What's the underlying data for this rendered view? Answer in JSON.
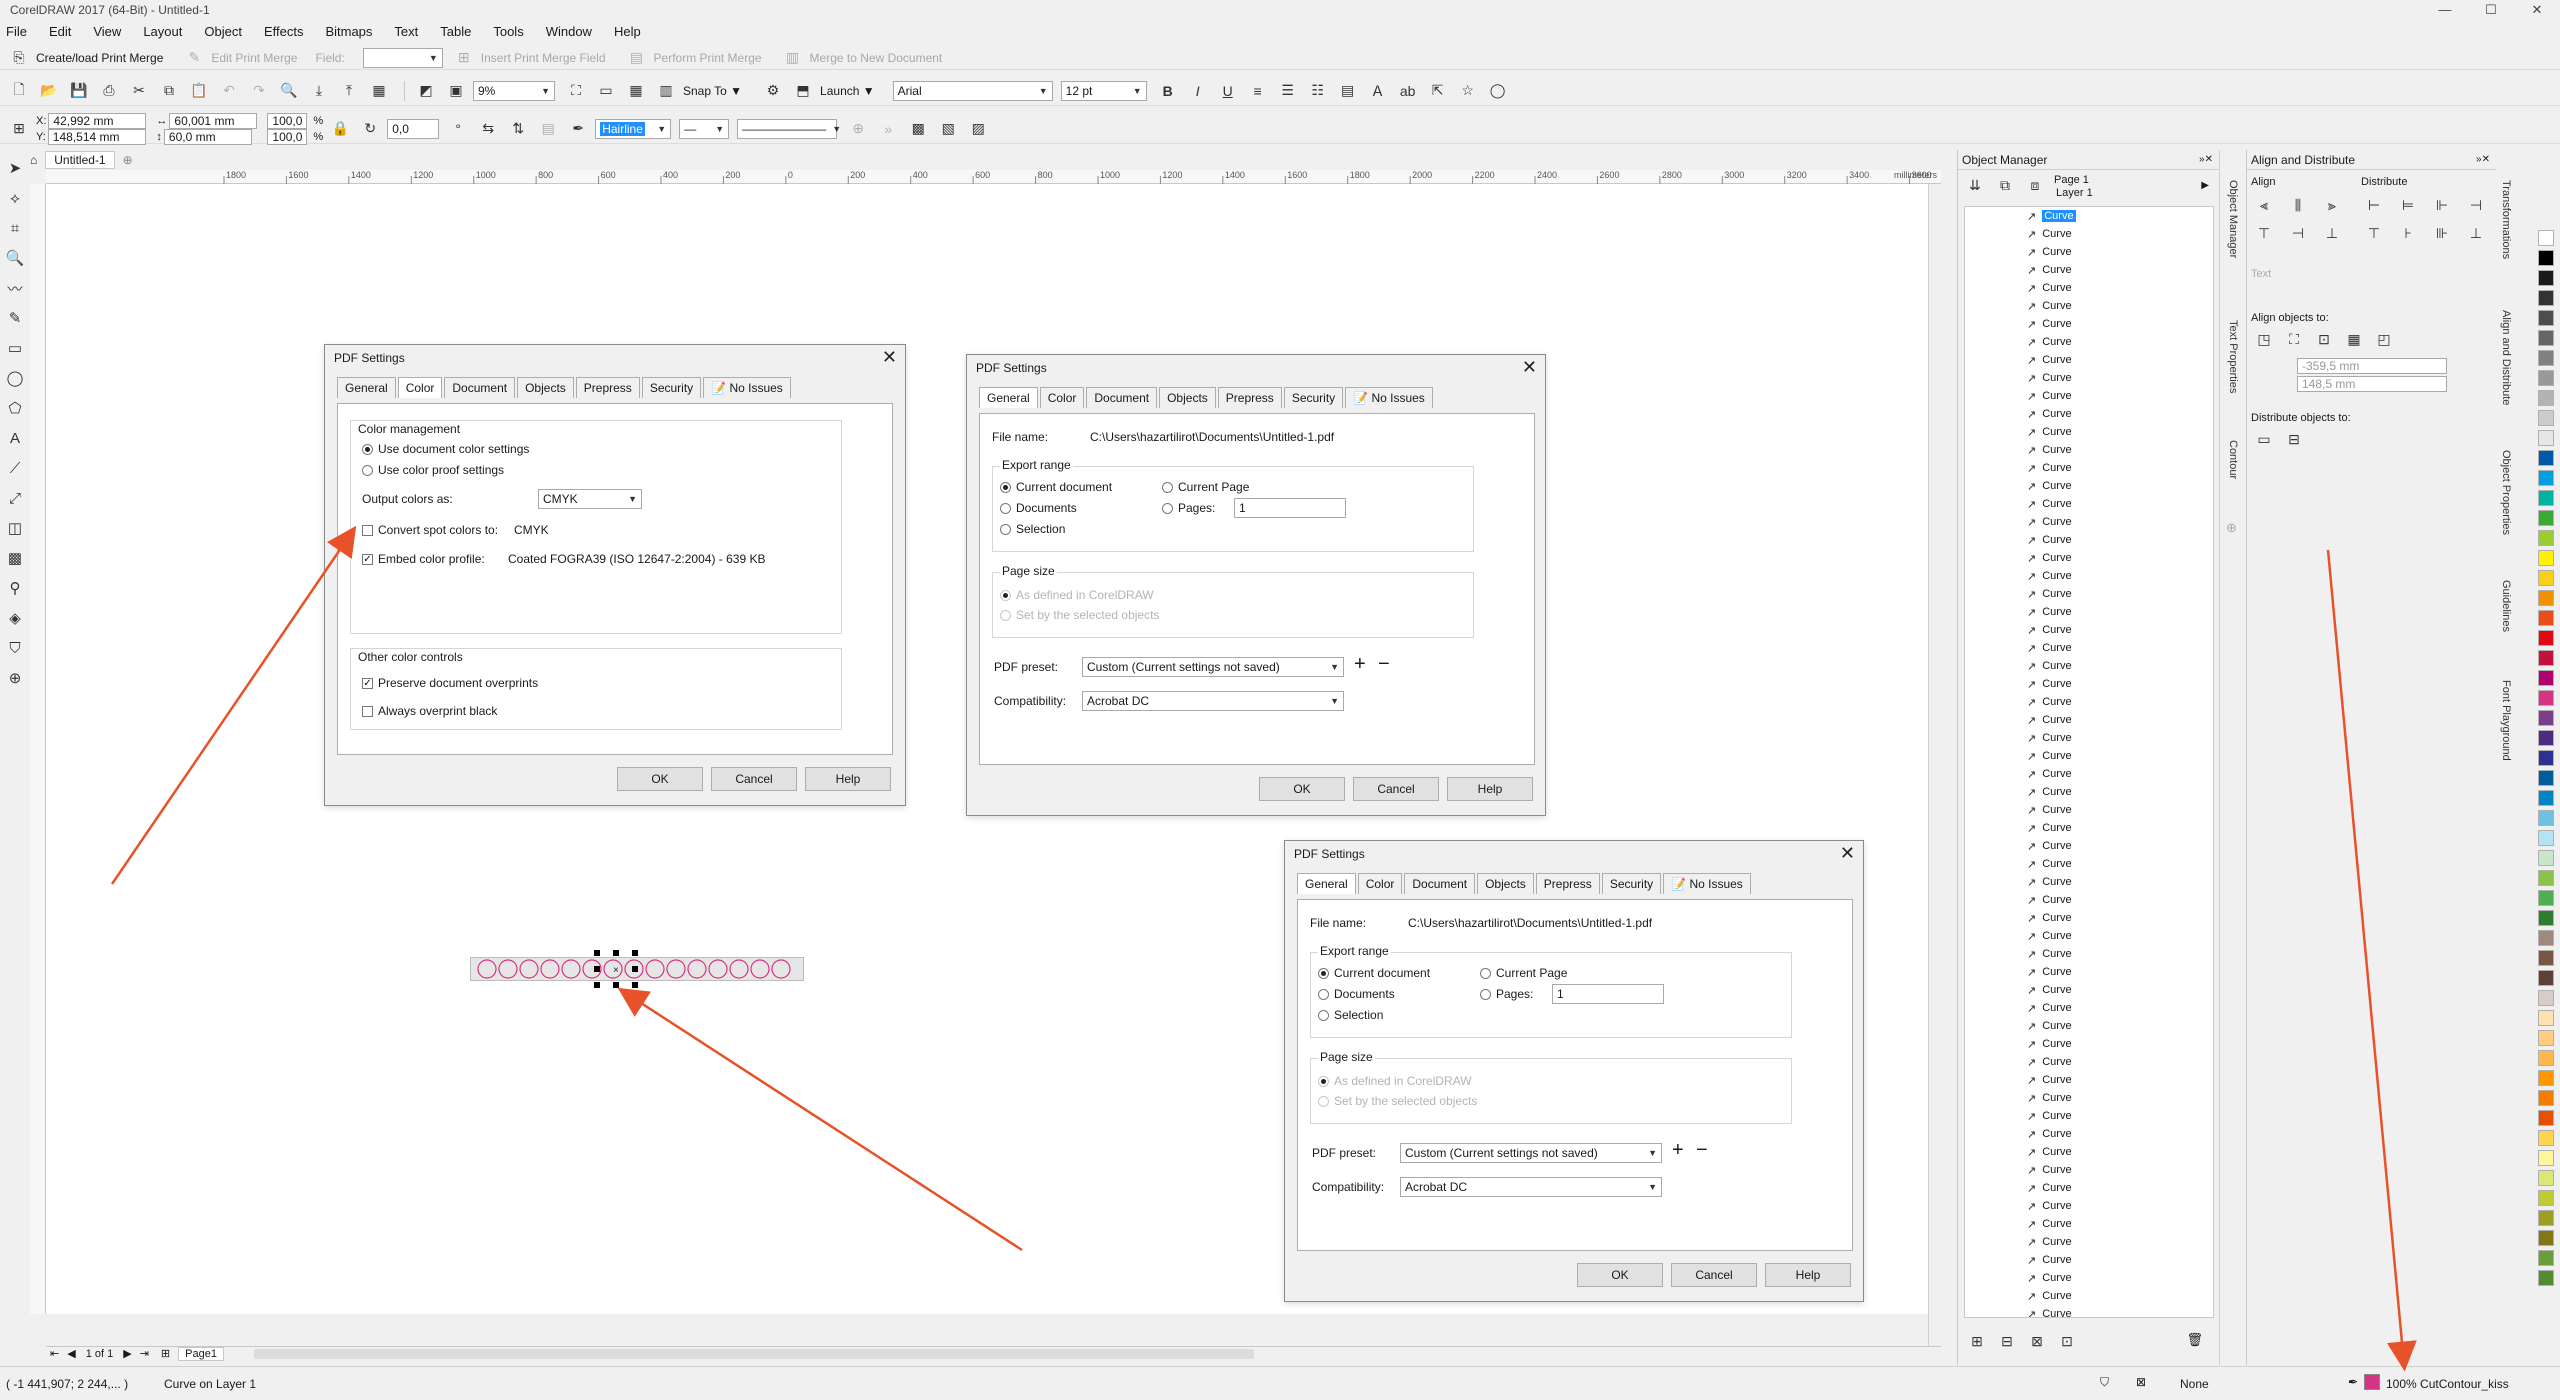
{
  "app": {
    "title": "CorelDRAW 2017 (64-Bit) - Untitled-1",
    "win_min": "—",
    "win_max": "☐",
    "win_close": "✕"
  },
  "menu": [
    "File",
    "Edit",
    "View",
    "Layout",
    "Object",
    "Effects",
    "Bitmaps",
    "Text",
    "Table",
    "Tools",
    "Window",
    "Help"
  ],
  "merge_toolbar": {
    "create_load": "Create/load Print Merge",
    "edit": "Edit Print Merge",
    "field_label": "Field:",
    "insert": "Insert Print Merge Field",
    "perform": "Perform Print Merge",
    "merge_new": "Merge to New Document"
  },
  "standard_toolbar": {
    "zoom": "9%",
    "snap_to": "Snap To",
    "launch": "Launch",
    "font": "Arial",
    "size": "12 pt"
  },
  "property_bar": {
    "x": "42,992 mm",
    "y": "148,514 mm",
    "w": "60,001 mm",
    "h": "60,0 mm",
    "sx": "100,0",
    "sy": "100,0",
    "pct": "%",
    "angle": "0,0",
    "outline": "Hairline"
  },
  "document_tab": "Untitled-1",
  "ruler_ticks": [
    "1800",
    "1600",
    "1400",
    "1200",
    "1000",
    "800",
    "600",
    "400",
    "200",
    "0",
    "200",
    "400",
    "600",
    "800",
    "1000",
    "1200",
    "1400",
    "1600",
    "1800",
    "2000",
    "2200",
    "2400",
    "2600",
    "2800",
    "3000",
    "3200",
    "3400",
    "3600"
  ],
  "ruler_unit": "millimeters",
  "dialog_color": {
    "title": "PDF Settings",
    "tabs": [
      "General",
      "Color",
      "Document",
      "Objects",
      "Prepress",
      "Security",
      "No Issues"
    ],
    "color_mgmt_label": "Color management",
    "use_doc": "Use document color settings",
    "use_proof": "Use color proof settings",
    "output_label": "Output colors as:",
    "output_value": "CMYK",
    "convert_spot": "Convert spot colors to:",
    "convert_value": "CMYK",
    "embed": "Embed color profile:",
    "embed_value": "Coated FOGRA39 (ISO 12647-2:2004) - 639 KB",
    "other_label": "Other color controls",
    "preserve": "Preserve document overprints",
    "always_black": "Always overprint black",
    "ok": "OK",
    "cancel": "Cancel",
    "help": "Help"
  },
  "dialog_general": {
    "title": "PDF Settings",
    "tabs": [
      "General",
      "Color",
      "Document",
      "Objects",
      "Prepress",
      "Security",
      "No Issues"
    ],
    "file_label": "File name:",
    "file_value": "C:\\Users\\hazartilirot\\Documents\\Untitled-1.pdf",
    "export_label": "Export range",
    "current_doc": "Current document",
    "documents": "Documents",
    "selection": "Selection",
    "current_page": "Current Page",
    "pages": "Pages:",
    "pages_value": "1",
    "pagesize_label": "Page size",
    "as_defined": "As defined in CorelDRAW",
    "set_by": "Set by the selected objects",
    "preset_label": "PDF preset:",
    "preset_value": "Custom (Current settings not saved)",
    "compat_label": "Compatibility:",
    "compat_value": "Acrobat DC",
    "ok": "OK",
    "cancel": "Cancel",
    "help": "Help"
  },
  "page_nav": {
    "of": "1 of 1",
    "page_tab": "Page1"
  },
  "object_manager": {
    "title": "Object Manager",
    "page": "Page 1",
    "layer": "Layer 1",
    "items": [
      "Curve",
      "Curve",
      "Curve",
      "Curve",
      "Curve",
      "Curve",
      "Curve",
      "Curve",
      "Curve",
      "Curve",
      "Curve",
      "Curve",
      "Curve",
      "Curve",
      "Curve",
      "Curve",
      "Curve",
      "Curve",
      "Curve",
      "Curve",
      "Curve",
      "Curve",
      "Curve",
      "Curve",
      "Curve",
      "Curve",
      "Curve",
      "Curve",
      "Curve",
      "Curve",
      "Curve",
      "Curve",
      "Curve",
      "Curve",
      "Curve",
      "Curve",
      "Curve",
      "Curve",
      "Curve",
      "Curve",
      "Curve",
      "Curve",
      "Curve",
      "Curve",
      "Curve",
      "Curve",
      "Curve",
      "Curve",
      "Curve",
      "Curve",
      "Curve",
      "Curve",
      "Curve",
      "Curve",
      "Curve",
      "Curve",
      "Curve",
      "Curve",
      "Curve",
      "Curve",
      "Curve",
      "Curve"
    ]
  },
  "align_panel": {
    "title": "Align and Distribute",
    "align": "Align",
    "distribute": "Distribute",
    "text": "Text",
    "align_to": "Align objects to:",
    "x_val": "-359,5 mm",
    "y_val": "148,5 mm",
    "distribute_to": "Distribute objects to:"
  },
  "side_tabs": [
    "Object Manager",
    "Text Properties",
    "Contour"
  ],
  "side_tabs2": [
    "Transformations",
    "Align and Distribute",
    "Object Properties",
    "Guidelines",
    "Font Playground"
  ],
  "status": {
    "coords": "( -1 441,907; 2 244,... )",
    "object": "Curve on Layer 1",
    "fill": "None",
    "outline": "100% CutContour_kiss"
  },
  "colors": {
    "accent_arrow": "#e8522a",
    "selection": "#1e90ff",
    "cutcontour": "#d63384"
  },
  "palette": [
    "#ffffff",
    "#000000",
    "#1a1a1a",
    "#333333",
    "#4d4d4d",
    "#666666",
    "#808080",
    "#999999",
    "#b3b3b3",
    "#cccccc",
    "#e6e6e6",
    "#0059a8",
    "#00a0e3",
    "#00b3a4",
    "#3aa935",
    "#9acd32",
    "#fff200",
    "#f7d117",
    "#f39200",
    "#e94e1b",
    "#e30613",
    "#c50f3c",
    "#b0006b",
    "#d63384",
    "#7a3e8a",
    "#4b2c84",
    "#2e3192",
    "#005b9f",
    "#0086c6",
    "#6ec1e4",
    "#b5e2f5",
    "#c8e6c9",
    "#8bc34a",
    "#4caf50",
    "#2e7d32",
    "#a1887f",
    "#795548",
    "#5d4037",
    "#d7ccc8",
    "#ffe0b2",
    "#ffcc80",
    "#ffb74d",
    "#ff9800",
    "#f57c00",
    "#e65100",
    "#ffd54f",
    "#fff59d",
    "#dce775",
    "#c0ca33",
    "#9e9d24",
    "#827717",
    "#689f38",
    "#558b2f"
  ]
}
